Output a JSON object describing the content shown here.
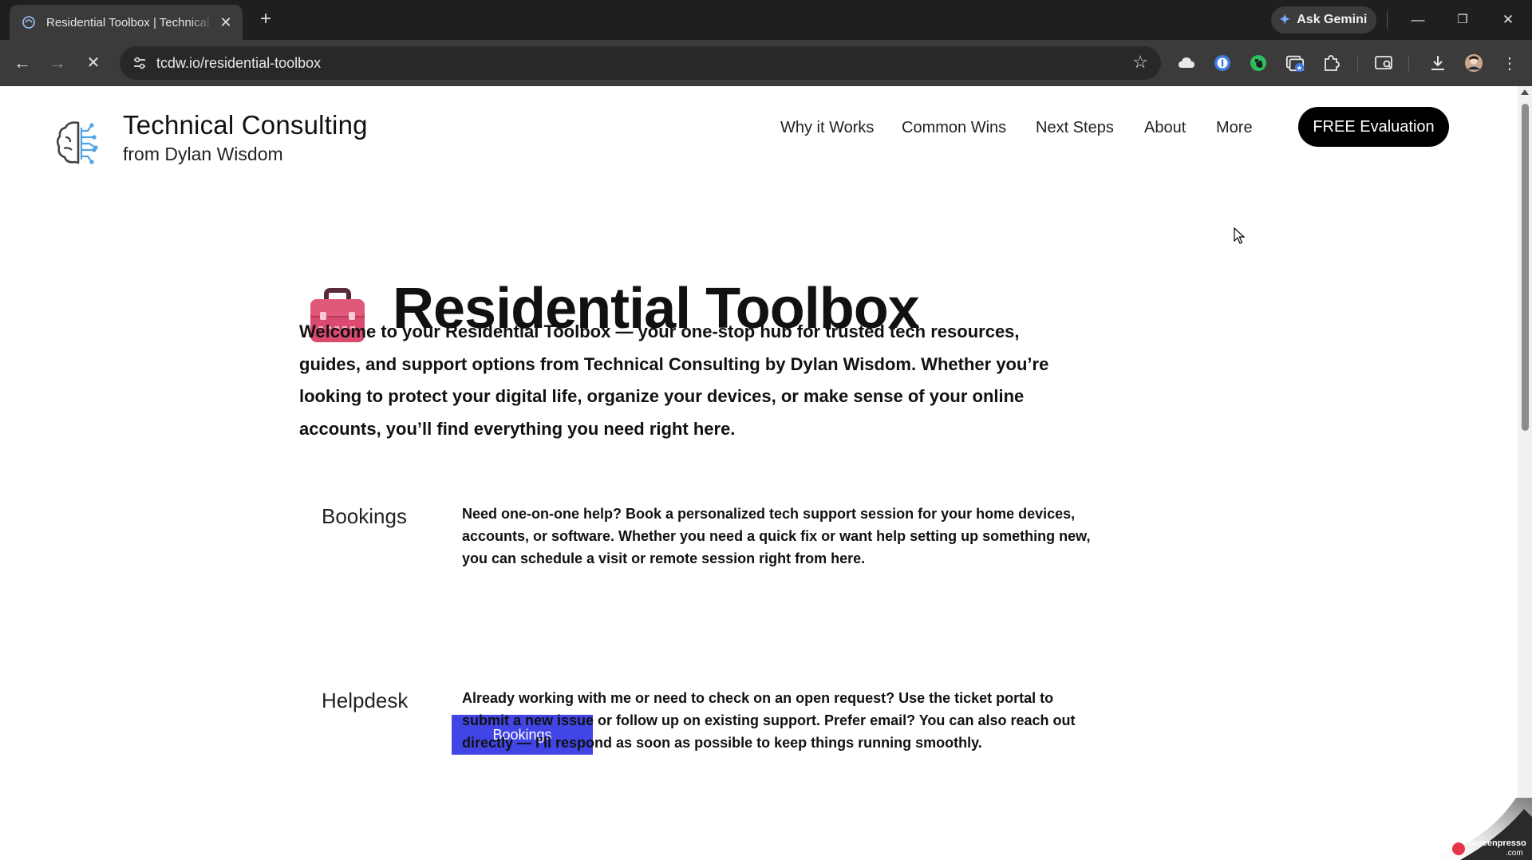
{
  "browser": {
    "tab_title": "Residential Toolbox | Technical Consulting",
    "tab_close": "✕",
    "new_tab": "+",
    "ask_gemini": "Ask Gemini",
    "url": "tcdw.io/residential-toolbox",
    "window_controls": {
      "minimize": "—",
      "restore": "❐",
      "close": "✕"
    },
    "nav": {
      "back": "←",
      "forward": "→",
      "stop": "✕"
    },
    "extensions": [
      "cloud-icon",
      "password-manager-icon",
      "evernote-icon",
      "tab-manager-icon",
      "puzzle-icon",
      "side-panel-search-icon",
      "download-icon",
      "profile-avatar"
    ]
  },
  "site": {
    "title": "Technical Consulting",
    "subtitle": "from Dylan Wisdom",
    "nav": [
      "Why it Works",
      "Common Wins",
      "Next Steps",
      "About",
      "More"
    ],
    "cta": "FREE Evaluation"
  },
  "hero": {
    "heading": "Residential Toolbox",
    "intro": "Welcome to your Residential Toolbox — your one-stop hub for trusted tech resources, guides, and support options from Technical Consulting by Dylan Wisdom. Whether you’re looking to protect your digital life, organize your devices, or make sense of your online accounts, you’ll find everything you need right here."
  },
  "sections": {
    "bookings": {
      "label": "Bookings",
      "text": "Need one-on-one help? Book a personalized tech support session for your home devices, accounts, or software. Whether you need a quick fix or want help setting up something new, you can schedule a visit or remote session right from here.",
      "button": "Bookings"
    },
    "helpdesk": {
      "label": "Helpdesk",
      "text": "Already working with me or need to check on an open request? Use the ticket portal to submit a new issue or follow up on existing support. Prefer email? You can also reach out directly — I’ll respond as soon as possible to keep things running smoothly."
    }
  },
  "watermark": "Screenpresso .com",
  "colors": {
    "chrome_dark": "#1f1f1f",
    "chrome_toolbar": "#3b3b3b",
    "cta": "#000000",
    "bookings_button": "#4145e6",
    "toolbox": "#d94a6e"
  }
}
